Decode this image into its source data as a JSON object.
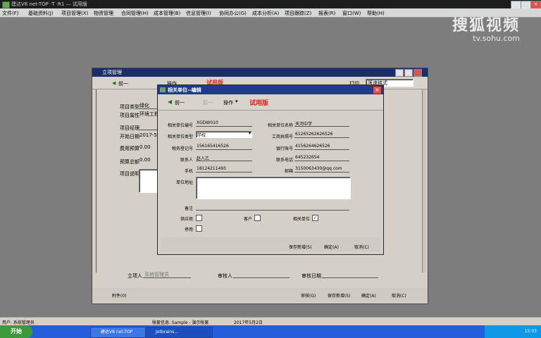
{
  "app": {
    "title": "建达V8 net-TOP ·T ·R1 — 试用版"
  },
  "watermark": {
    "brand": "搜狐视频",
    "url": "tv.sohu.com"
  },
  "menu": [
    "文件(F)",
    "基础资料(J)",
    "项目管理(X)",
    "物资管理",
    "合同管理(H)",
    "成本管理(B)",
    "信息管理(I)",
    "协同办公(G)",
    "成本分析(A)",
    "项目跟踪(Z)",
    "报表(R)",
    "窗口(W)",
    "帮助(H)"
  ],
  "bg_window": {
    "title": "立项管理",
    "toolbar": {
      "prev": "前一",
      "ops": "操作",
      "trial": "试用版",
      "print": "打印",
      "print_format": "限速格式"
    },
    "fields": {
      "type_label": "项目类型",
      "type_value": "绿化",
      "category_label": "项目属性",
      "category_value": "环境工程",
      "manager_label": "项目经理",
      "manager_value": "",
      "start_label": "开始日期",
      "start_value": "2017-5-2",
      "budget_label": "费用预算",
      "budget_value": "0.00",
      "total_label": "预算总额",
      "total_value": "0.00",
      "desc_label": "项目说明"
    },
    "footer": {
      "creator_label": "立项人",
      "creator_value": "系统管理员",
      "reviewer_label": "审核人",
      "review_date_label": "审核日期",
      "attach": "附件(0)",
      "audit": "审核(G)",
      "save_new": "保存新增(S)",
      "ok": "确定(A)",
      "cancel": "取消(C)"
    }
  },
  "dialog": {
    "title": "相关单位--编辑",
    "toolbar": {
      "prev": "前一",
      "next": "后一",
      "ops": "操作",
      "trial": "试用版"
    },
    "fields": {
      "code_label": "相关单位编号",
      "code_value": "XGDW010",
      "name_label": "相关单位名称",
      "name_value": "天河中学",
      "type_label": "相关单位类型",
      "type_value": "学校",
      "license_label": "工商执照号",
      "license_value": "61265262626526",
      "tax_label": "税务登记号",
      "tax_value": "156165416526",
      "bank_label": "银行账号",
      "bank_value": "4156264626526",
      "contact_label": "联系人",
      "contact_value": "赵人乙",
      "phone_label": "联系电话",
      "phone_value": "645232654",
      "mobile_label": "手机",
      "mobile_value": "18124211493",
      "email_label": "邮箱",
      "email_value": "3150063430@qq.com",
      "address_label": "单位地址",
      "address_value": "",
      "remark_label": "备注",
      "remark_value": ""
    },
    "checks": [
      {
        "label": "供应商",
        "checked": false
      },
      {
        "label": "客户",
        "checked": false
      },
      {
        "label": "相关单位",
        "checked": true
      },
      {
        "label": "停用",
        "checked": false
      }
    ],
    "buttons": {
      "save_new": "保存新增(S)",
      "ok": "确定(A)",
      "cancel": "取消(C)"
    }
  },
  "status": {
    "user": "用户: 系统管理员",
    "account": "帐套信息: Sample - 演示帐套",
    "date": "2017年5月2日"
  },
  "taskbar": {
    "start": "开始",
    "tasks": [
      "建达V8 net-TOP",
      "Jetbrains...",
      "netcatalog..."
    ],
    "clock": "15:03"
  }
}
